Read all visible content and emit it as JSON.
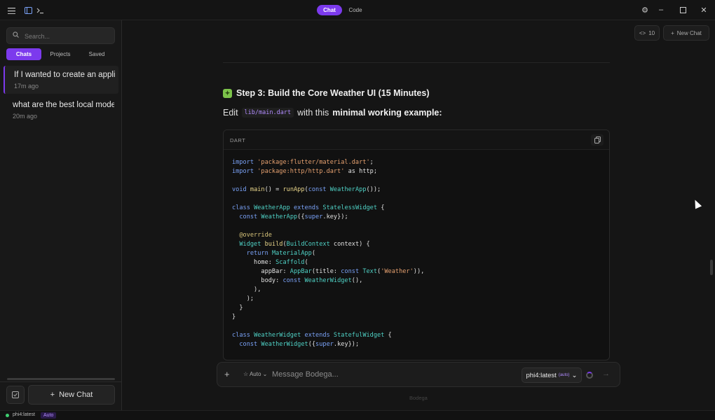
{
  "titlebar": {
    "mode_tabs": [
      "Chat",
      "Code"
    ],
    "active_mode": "Chat",
    "icons": [
      "menu-icon",
      "sidebar-toggle-icon",
      "terminal-icon",
      "settings-icon",
      "minimize-icon",
      "maximize-icon",
      "close-icon"
    ]
  },
  "sidebar": {
    "search_placeholder": "Search...",
    "tabs": [
      "Chats",
      "Projects",
      "Saved"
    ],
    "active_tab": "Chats",
    "chats": [
      {
        "title": "If I wanted to create an appli",
        "time": "17m ago",
        "active": true
      },
      {
        "title": "what are the best local mode",
        "time": "20m ago",
        "active": false
      }
    ],
    "new_chat_label": "New Chat"
  },
  "main": {
    "code_count": "10",
    "new_chat_label": "New Chat",
    "heading": "Step 3: Build the Core Weather UI (15 Minutes)",
    "para_prefix": "Edit",
    "para_code": "lib/main.dart",
    "para_middle": "with this",
    "para_bold": "minimal working example:",
    "code_lang": "DART"
  },
  "composer": {
    "auto_label": "Auto",
    "placeholder": "Message Bodega...",
    "model": "phi4:latest",
    "model_badge": "(auto)"
  },
  "brand": "Bodega",
  "status": {
    "model": "phi4:latest",
    "badge": "Auto"
  },
  "colors": {
    "accent": "#7c3aed",
    "status_ok": "#3ecf70"
  }
}
